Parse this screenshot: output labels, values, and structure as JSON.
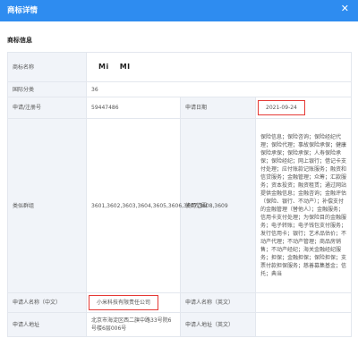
{
  "dialog": {
    "title": "商标详情",
    "close_glyph": "✕"
  },
  "section_title": "商标信息",
  "fields": {
    "name_label": "商标名称",
    "name_value_1": "Mi",
    "name_value_2": "MI",
    "intl_class_label": "国际分类",
    "intl_class_value": "36",
    "reg_no_label": "申请/注册号",
    "reg_no_value": "59447486",
    "apply_date_label": "申请日期",
    "apply_date_value": "2021-09-24",
    "group_label": "类似群组",
    "group_value": "3601,3602,3603,3604,3605,3606,3607,3608,3609",
    "scope_label": "使用范围",
    "scope_value": "保险信息；保险咨询；保险经纪代理；保险代理；事故保险承保；健康保险承保；保险承保；人寿保险承保；保险经纪；网上银行；借记卡支付处理；应付账款记账服务；融资和信贷服务；金融管理；众筹；汇款服务；资本投资；融资租赁；通过网站提供金融信息；金融咨询；金融评估（保险、银行、不动产）；补偿支付的金融管理（替他人）；金融服务；信用卡支付处理；为保险目的金融服务；电子转账；电子钱包支付服务；发行信用卡；银行；艺术品估价；不动产代理；不动产管理；商品房销售；不动产经纪；海关金融经纪服务；担保；金融担保；保险担保；支票付款担保服务；慈善募集基金；信托；典当",
    "applicant_cn_label": "申请人名称（中文）",
    "applicant_cn_value": "小米科技有限责任公司",
    "applicant_en_label": "申请人名称（英文）",
    "applicant_en_value": "",
    "address_cn_label": "申请人地址",
    "address_cn_value": "北京市海淀区西二旗中路33号院6号楼6层006号",
    "address_en_label": "申请人地址（英文）",
    "address_en_value": ""
  },
  "colors": {
    "header_bg": "#2e8cf0",
    "label_bg": "#f1f4f9",
    "highlight": "#e53935"
  }
}
